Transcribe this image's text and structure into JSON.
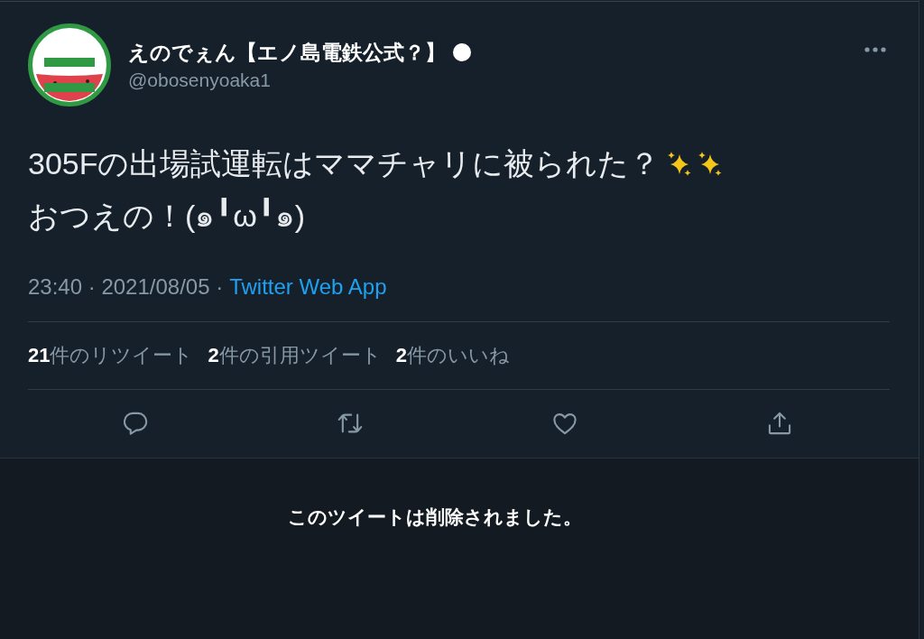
{
  "author": {
    "name": "えのでぇん【エノ島電鉄公式？】",
    "handle": "@obosenyoaka1"
  },
  "tweet": {
    "lines": [
      {
        "segments": [
          {
            "kind": "text",
            "text": "305Fの出場試運転はママチャリに被られた？"
          },
          {
            "kind": "sparkles"
          },
          {
            "kind": "sparkles"
          }
        ]
      },
      {
        "segments": [
          {
            "kind": "text",
            "text": "おつえの！(๑╹ω╹๑)"
          }
        ]
      }
    ],
    "meta": "23:40 · 2021/08/05 ·",
    "source": "Twitter Web App"
  },
  "stats": [
    {
      "count": "21",
      "label": "件のリツイート"
    },
    {
      "count": "2",
      "label": "件の引用ツイート"
    },
    {
      "count": "2",
      "label": "件のいいね"
    }
  ],
  "actions": [
    {
      "kind": "reply"
    },
    {
      "kind": "retweet"
    },
    {
      "kind": "like"
    },
    {
      "kind": "share"
    }
  ],
  "deleted_notice": "このツイートは削除されました。"
}
